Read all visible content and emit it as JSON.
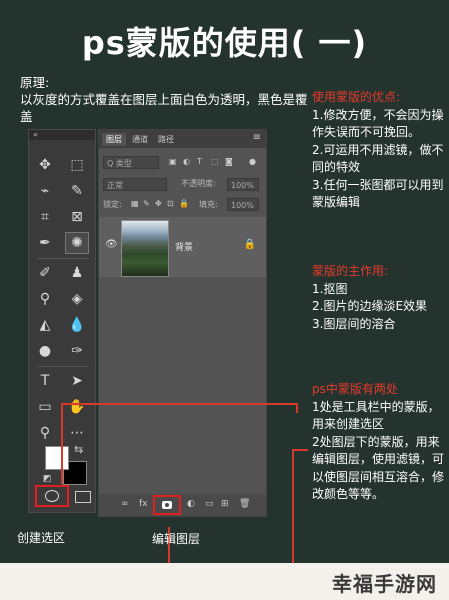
{
  "title": "ps蒙版的使用(  一)",
  "principle": {
    "heading": "原理:",
    "body": "以灰度的方式覆盖在图层上面白色为透明，黑色是覆盖"
  },
  "toolbar": {
    "collapse_label": "«",
    "tools": [
      "move",
      "marquee",
      "lasso",
      "quick-select",
      "crop",
      "frame",
      "eyedropper",
      "spot-heal",
      "brush",
      "stamp",
      "history-brush",
      "eraser",
      "bucket",
      "blur",
      "dodge",
      "pen",
      "type",
      "path-select",
      "rectangle",
      "hand",
      "zoom",
      "more"
    ]
  },
  "layers_panel": {
    "tabs": [
      "图层",
      "通道",
      "路径"
    ],
    "kind_label": "Q 类型",
    "blend_mode": "正常",
    "opacity_label": "不透明度:",
    "opacity_value": "100%",
    "lock_label": "锁定:",
    "fill_label": "填充:",
    "fill_value": "100%",
    "layer_name": "背景"
  },
  "notes": {
    "advantages_heading": "使用蒙版的优点:",
    "advantages": [
      "1.修改方便，不会因为操作失误而不可挽回。",
      "2.可运用不用滤镜，做不同的特效",
      "3.任何一张图都可以用到蒙版编辑"
    ],
    "purpose_heading": "蒙版的主作用:",
    "purposes": [
      "1.抠图",
      "2.图片的边缘淡E效果",
      "3.图层间的溶合"
    ],
    "places_heading": "ps中蒙版有两处",
    "places": [
      "1处是工具栏中的蒙版，用来创建选区",
      "2处图层下的蒙版，用来编辑图层，使用滤镜，可以使图层间相互溶合，修改颜色等等。"
    ]
  },
  "captions": {
    "create_selection": "创建选区",
    "edit_layer": "编辑图层"
  },
  "watermark": "幸福手游网",
  "colors": {
    "background": "#25332f",
    "accent_red": "#e53a2a"
  }
}
